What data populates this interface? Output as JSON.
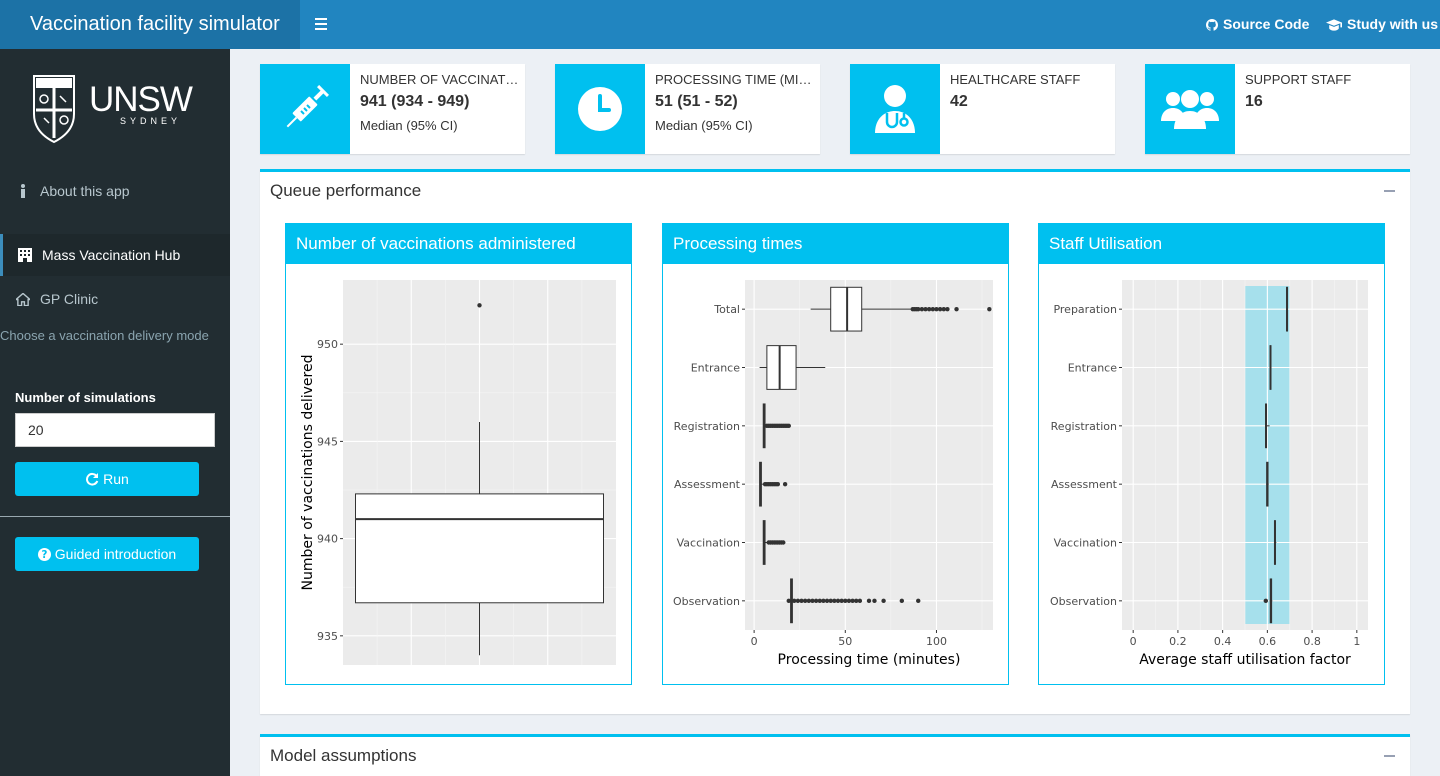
{
  "app": {
    "title": "Vaccination facility simulator",
    "links": [
      {
        "label": "Source Code",
        "icon": "github-icon"
      },
      {
        "label": "Study with us",
        "icon": "graduation-cap-icon"
      }
    ]
  },
  "sidebar": {
    "logo": {
      "name": "UNSW",
      "sub": "SYDNEY"
    },
    "items": [
      {
        "label": "About this app",
        "icon": "info-icon"
      },
      {
        "label": "Mass Vaccination Hub",
        "icon": "building-icon",
        "active": true
      },
      {
        "label": "GP Clinic",
        "icon": "home-icon"
      }
    ],
    "hint": "Choose a vaccination delivery mode",
    "simulations_label": "Number of simulations",
    "simulations_value": "20",
    "run_label": "Run",
    "guide_label": "Guided introduction"
  },
  "info_boxes": [
    {
      "title": "Number of vaccinations delivered",
      "value": "941 (934 - 949)",
      "sub": "Median (95% CI)",
      "icon": "syringe-icon"
    },
    {
      "title": "Processing time (minutes)",
      "value": "51 (51 - 52)",
      "sub": "Median (95% CI)",
      "icon": "clock-icon"
    },
    {
      "title": "Healthcare staff",
      "value": "42",
      "sub": "",
      "icon": "user-doctor-icon"
    },
    {
      "title": "Support staff",
      "value": "16",
      "sub": "",
      "icon": "users-icon"
    }
  ],
  "sections": {
    "queue_title": "Queue performance",
    "assumptions_title": "Model assumptions"
  },
  "colors": {
    "accent": "#00c0ef",
    "header": "#2185c0",
    "sidebar": "#222d32",
    "band": "#a6e0ec"
  },
  "chart_data": [
    {
      "type": "box",
      "title": "Number of vaccinations administered",
      "xlabel": "",
      "ylabel": "Number of vaccinations delivered",
      "ylim": [
        933.5,
        953.3
      ],
      "yticks": [
        935,
        940,
        945,
        950
      ],
      "box": {
        "whisker_low": 934,
        "q1": 936.7,
        "median": 941,
        "q3": 942.3,
        "whisker_high": 946
      },
      "outliers": [
        952
      ]
    },
    {
      "type": "box",
      "orientation": "horizontal",
      "title": "Processing times",
      "xlabel": "Processing time (minutes)",
      "ylabel": "",
      "xlim": [
        -5,
        131
      ],
      "xticks": [
        0,
        50,
        100
      ],
      "categories": [
        "Total",
        "Entrance",
        "Registration",
        "Assessment",
        "Vaccination",
        "Observation"
      ],
      "boxes": [
        {
          "whisker_low": 31,
          "q1": 42,
          "median": 51,
          "q3": 59,
          "whisker_high": 86,
          "outliers": [
            87,
            88,
            89,
            90,
            92,
            94,
            96,
            98,
            100,
            102,
            104,
            106,
            111,
            129
          ]
        },
        {
          "whisker_low": 3,
          "q1": 7,
          "median": 14,
          "q3": 23,
          "whisker_high": 39,
          "outliers": []
        },
        {
          "whisker_low": 5,
          "q1": 5,
          "median": 5.5,
          "q3": 6,
          "whisker_high": 6.5,
          "outliers": [
            7,
            8,
            9,
            10,
            11,
            12,
            13,
            14,
            15,
            16,
            17,
            18,
            19
          ]
        },
        {
          "whisker_low": 3,
          "q1": 3,
          "median": 3.5,
          "q3": 4,
          "whisker_high": 5,
          "outliers": [
            6,
            7,
            8,
            9,
            10,
            11,
            12,
            13,
            17
          ]
        },
        {
          "whisker_low": 5,
          "q1": 5,
          "median": 5.5,
          "q3": 6,
          "whisker_high": 7,
          "outliers": [
            8,
            9,
            10,
            11,
            12,
            13,
            14,
            15,
            16
          ]
        },
        {
          "whisker_low": 20,
          "q1": 20,
          "median": 20.5,
          "q3": 21,
          "whisker_high": 21.5,
          "outliers": [
            19,
            22,
            24,
            26,
            28,
            30,
            32,
            34,
            36,
            38,
            40,
            42,
            44,
            46,
            48,
            50,
            52,
            54,
            56,
            58,
            63,
            66,
            71,
            81,
            90
          ]
        }
      ]
    },
    {
      "type": "box",
      "orientation": "horizontal",
      "title": "Staff Utilisation",
      "xlabel": "Average staff utilisation factor",
      "ylabel": "",
      "xlim": [
        -0.05,
        1.05
      ],
      "xticks": [
        "0",
        "0.2",
        "0.4",
        "0.6",
        "0.8",
        "1"
      ],
      "band": [
        0.5,
        0.7
      ],
      "categories": [
        "Preparation",
        "Entrance",
        "Registration",
        "Assessment",
        "Vaccination",
        "Observation"
      ],
      "boxes": [
        {
          "whisker_low": 0.684,
          "q1": 0.686,
          "median": 0.688,
          "q3": 0.69,
          "whisker_high": 0.692,
          "outliers": []
        },
        {
          "whisker_low": 0.61,
          "q1": 0.612,
          "median": 0.614,
          "q3": 0.616,
          "whisker_high": 0.618,
          "outliers": []
        },
        {
          "whisker_low": 0.59,
          "q1": 0.592,
          "median": 0.594,
          "q3": 0.596,
          "whisker_high": 0.61,
          "outliers": []
        },
        {
          "whisker_low": 0.595,
          "q1": 0.597,
          "median": 0.6,
          "q3": 0.603,
          "whisker_high": 0.606,
          "outliers": []
        },
        {
          "whisker_low": 0.63,
          "q1": 0.632,
          "median": 0.634,
          "q3": 0.636,
          "whisker_high": 0.64,
          "outliers": []
        },
        {
          "whisker_low": 0.61,
          "q1": 0.613,
          "median": 0.616,
          "q3": 0.619,
          "whisker_high": 0.622,
          "outliers": [
            0.593
          ]
        }
      ]
    }
  ]
}
